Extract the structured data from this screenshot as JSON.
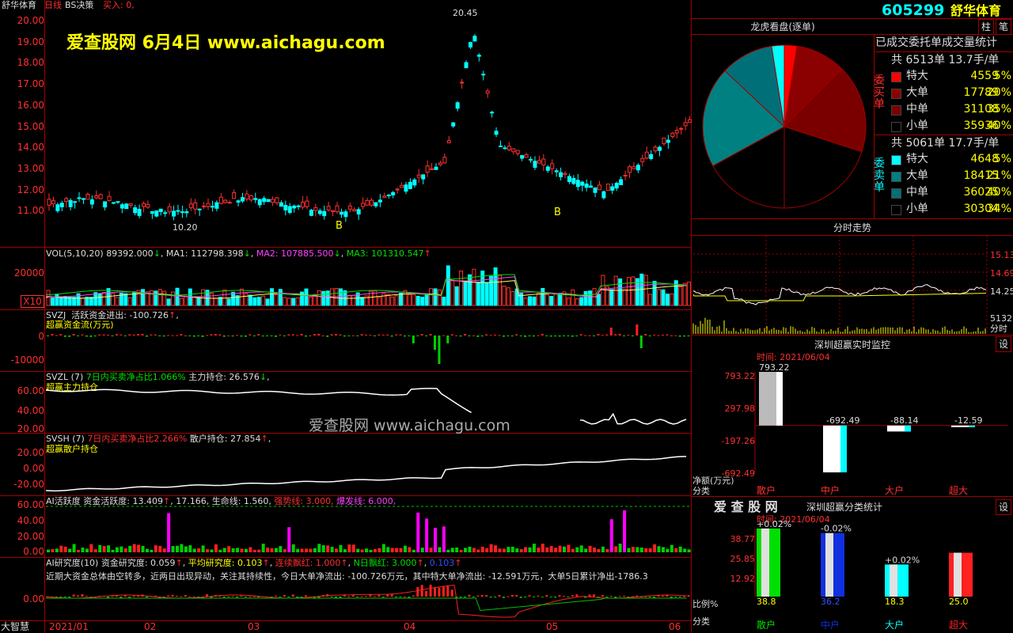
{
  "main_chart": {
    "title": "舒华体育",
    "period": "日线",
    "indicator": "BS决策",
    "buy_label": "买入: 0,",
    "watermark": "爱查股网   6月4日   www.aichagu.com",
    "y_ticks": [
      "20.00",
      "19.00",
      "18.00",
      "17.00",
      "16.00",
      "15.00",
      "14.00",
      "13.00",
      "12.00",
      "11.00"
    ],
    "low_marker": "10.20",
    "high_marker": "20.45",
    "buy_markers": [
      "B",
      "B"
    ]
  },
  "volume": {
    "label": "VOL(5,10,20)",
    "value": "89392.000",
    "ma1": "MA1: 112798.398",
    "ma2": "MA2: 107885.500",
    "ma3": "MA3: 101310.547",
    "y_ticks": [
      "20000",
      "X10"
    ]
  },
  "svzj": {
    "label": "SVZJ",
    "desc": "活跃资金进出: -100.726",
    "sub": "超赢资金流(万元)",
    "y_ticks": [
      "0",
      "-10000"
    ]
  },
  "svzl": {
    "label": "SVZL (7)",
    "line1": "7日内买卖净占比1.066%",
    "line2": "主力持仓: 26.576",
    "sub": "超赢主力持仓",
    "y_ticks": [
      "60.00",
      "40.00",
      "20.00"
    ],
    "watermark": "爱查股网    www.aichagu.com"
  },
  "svsh": {
    "label": "SVSH (7)",
    "line1": "7日内买卖净占比2.266%",
    "line2": "散户持仓: 27.854",
    "sub": "超赢散户持仓",
    "y_ticks": [
      "20.00",
      "0.00",
      "-20.00"
    ]
  },
  "ai_active": {
    "label": "AI活跃度",
    "text": "资金活跃度: 13.409",
    "v2": "17.166,",
    "life": "生命线: 1.560,",
    "strong": "强势线: 3.000,",
    "burst": "爆发线: 6.000,",
    "y_ticks": [
      "60.00",
      "40.00",
      "20.00",
      "0.00"
    ]
  },
  "ai_research": {
    "label": "AI研究度(10)",
    "text": "资金研究度: 0.059",
    "avg": "平均研究度: 0.103",
    "red_label": "连续飘红: 1.000",
    "n_red": "N日飘红: 3.000",
    "v3": "0.103",
    "summary": "近期大资金总体由空转多，近两日出现异动，关注其持续性，今日大单净流出: -100.726万元，其中特大单净流出: -12.591万元，大单5日累计净出-1786.3",
    "y_tick": "0.00"
  },
  "x_axis": {
    "labels": [
      "2021/01",
      "02",
      "03",
      "04",
      "05",
      "06"
    ],
    "corner": "大智慧"
  },
  "right_panel": {
    "code": "605299",
    "name": "舒华体育",
    "btn1": "柱",
    "btn2": "笔",
    "pie_title": "龙虎看盘(逐单)",
    "stat_title": "已成交委托单成交量统计",
    "buy": {
      "total": "共 6513单 13.7手/单",
      "side": "委买单",
      "rows": [
        {
          "label": "特大",
          "value": "4559",
          "pct": "5%",
          "color": "#ff0000"
        },
        {
          "label": "大单",
          "value": "17789",
          "pct": "20%",
          "color": "#8b0000"
        },
        {
          "label": "中单",
          "value": "31108",
          "pct": "35%",
          "color": "#7a0000"
        },
        {
          "label": "小单",
          "value": "35936",
          "pct": "40%",
          "color": "#000000"
        }
      ]
    },
    "sell": {
      "total": "共 5061单 17.7手/单",
      "side": "委卖单",
      "rows": [
        {
          "label": "特大",
          "value": "4648",
          "pct": "5%",
          "color": "#00ffff"
        },
        {
          "label": "大单",
          "value": "18415",
          "pct": "21%",
          "color": "#008080"
        },
        {
          "label": "中单",
          "value": "36025",
          "pct": "40%",
          "color": "#006f78"
        },
        {
          "label": "小单",
          "value": "30304",
          "pct": "34%",
          "color": "#000000"
        }
      ]
    },
    "pie_data": [
      {
        "name": "买特大",
        "pct": 5,
        "color": "#ff0000"
      },
      {
        "name": "买大单",
        "pct": 20,
        "color": "#8b0000"
      },
      {
        "name": "买中单",
        "pct": 35,
        "color": "#7a0000"
      },
      {
        "name": "买小单",
        "pct": 40,
        "color": "#000000"
      },
      {
        "name": "卖小单",
        "pct": 34,
        "color": "#000000"
      },
      {
        "name": "卖中单",
        "pct": 40,
        "color": "#008080"
      },
      {
        "name": "卖大单",
        "pct": 21,
        "color": "#006f78"
      },
      {
        "name": "卖特大",
        "pct": 5,
        "color": "#00ffff"
      }
    ],
    "intraday_title": "分时走势",
    "intraday_ticks": [
      "15.13",
      "14.69",
      "14.25",
      "5132"
    ],
    "intraday_unit": "分时",
    "monitor": {
      "title": "深圳超赢实时监控",
      "gear": "设",
      "time": "时间: 2021/06/04",
      "y_ticks": [
        "793.22",
        "297.98",
        "-197.26",
        "-692.49"
      ],
      "unit": "净额(万元)",
      "cat_label": "分类",
      "categories": [
        "散户",
        "中户",
        "大户",
        "超大"
      ],
      "values": [
        "793.22",
        "-692.49",
        "-88.14",
        "-12.59"
      ]
    },
    "classify": {
      "logo": "爱 查 股 网",
      "title": "深圳超赢分类统计",
      "gear": "设",
      "time": "时间: 2021/06/04",
      "y_ticks": [
        "38.77",
        "25.85",
        "12.92"
      ],
      "unit": "比例%",
      "cat_label": "分类",
      "categories": [
        "散户",
        "中户",
        "大户",
        "超大"
      ],
      "values": [
        "38.8",
        "36.2",
        "18.3",
        "25.0"
      ],
      "changes": [
        "+0.02%",
        "-0.02%",
        "+0.02%",
        ""
      ],
      "colors": [
        "#00e000",
        "#1030e0",
        "#00ffff",
        "#ff2020"
      ]
    }
  },
  "chart_data": [
    {
      "type": "bar",
      "title": "深圳超赢实时监控",
      "categories": [
        "散户",
        "中户",
        "大户",
        "超大"
      ],
      "values": [
        793.22,
        -692.49,
        -88.14,
        -12.59
      ],
      "ylabel": "净额(万元)",
      "ylim": [
        -692.49,
        793.22
      ]
    },
    {
      "type": "bar",
      "title": "深圳超赢分类统计",
      "categories": [
        "散户",
        "中户",
        "大户",
        "超大"
      ],
      "values": [
        38.8,
        36.2,
        18.3,
        25.0
      ],
      "ylabel": "比例%",
      "ylim": [
        0,
        38.77
      ]
    },
    {
      "type": "pie",
      "title": "龙虎看盘(逐单)",
      "categories": [
        "买特大",
        "买大单",
        "买中单",
        "买小单",
        "卖小单",
        "卖中单",
        "卖大单",
        "卖特大"
      ],
      "values": [
        5,
        20,
        35,
        40,
        34,
        40,
        21,
        5
      ]
    }
  ]
}
